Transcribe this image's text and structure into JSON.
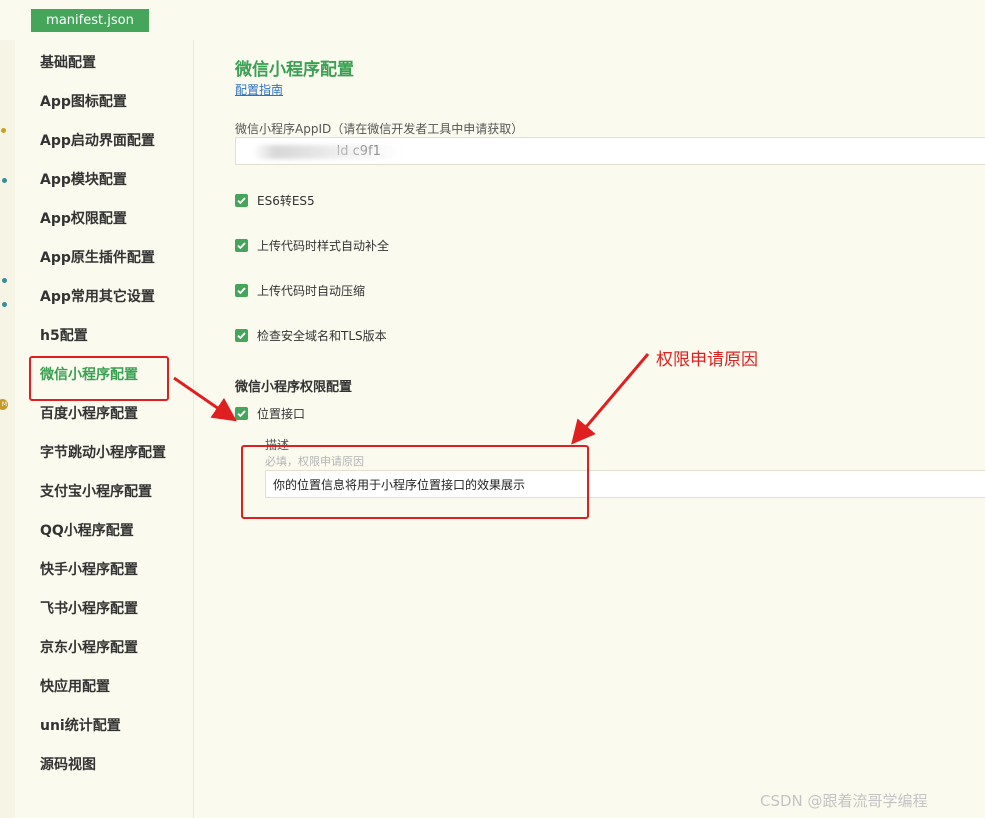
{
  "tab": {
    "label": "manifest.json"
  },
  "sidebar": {
    "items": [
      {
        "label": "基础配置"
      },
      {
        "label": "App图标配置"
      },
      {
        "label": "App启动界面配置"
      },
      {
        "label": "App模块配置"
      },
      {
        "label": "App权限配置"
      },
      {
        "label": "App原生插件配置"
      },
      {
        "label": "App常用其它设置"
      },
      {
        "label": "h5配置"
      },
      {
        "label": "微信小程序配置",
        "active": true
      },
      {
        "label": "百度小程序配置"
      },
      {
        "label": "字节跳动小程序配置"
      },
      {
        "label": "支付宝小程序配置"
      },
      {
        "label": "QQ小程序配置"
      },
      {
        "label": "快手小程序配置"
      },
      {
        "label": "飞书小程序配置"
      },
      {
        "label": "京东小程序配置"
      },
      {
        "label": "快应用配置"
      },
      {
        "label": "uni统计配置"
      },
      {
        "label": "源码视图"
      }
    ]
  },
  "main": {
    "title": "微信小程序配置",
    "guide_link": "配置指南",
    "appid": {
      "label": "微信小程序AppID（请在微信开发者工具中申请获取）",
      "value": "                    ld c9f1 "
    },
    "options": [
      {
        "label": "ES6转ES5",
        "checked": true
      },
      {
        "label": "上传代码时样式自动补全",
        "checked": true
      },
      {
        "label": "上传代码时自动压缩",
        "checked": true
      },
      {
        "label": "检查安全域名和TLS版本",
        "checked": true
      }
    ],
    "permissions": {
      "title": "微信小程序权限配置",
      "location": {
        "label": "位置接口",
        "checked": true
      },
      "desc_label": "描述",
      "desc_hint": "必填，权限申请原因",
      "desc_value": "你的位置信息将用于小程序位置接口的效果展示"
    }
  },
  "annotation": {
    "text": "权限申请原因",
    "color": "#e02020"
  },
  "watermark": "CSDN @跟着流哥学编程",
  "colors": {
    "accent": "#45a55a",
    "active_text": "#3aa152",
    "link": "#2b73c4",
    "background": "#fbfaef",
    "annotation": "#e02020"
  }
}
